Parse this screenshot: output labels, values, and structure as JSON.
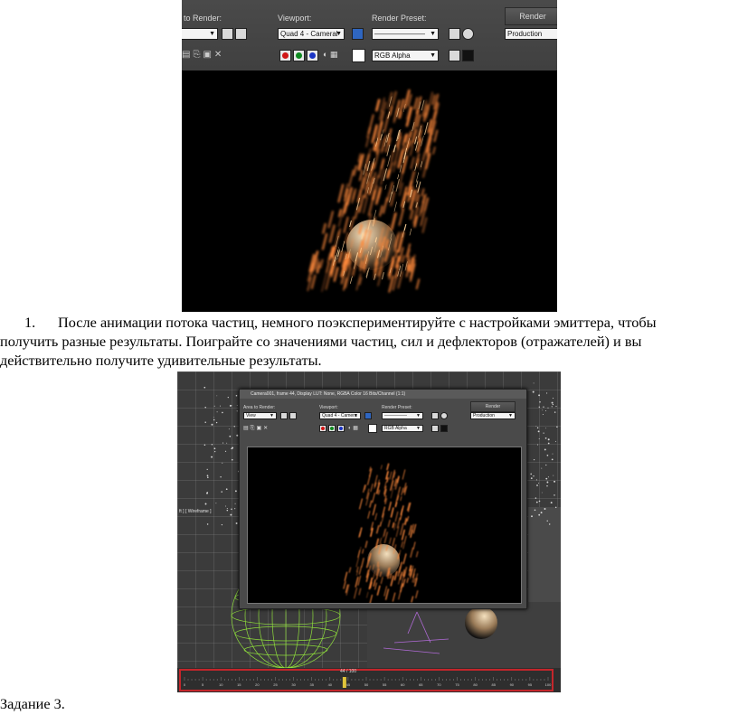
{
  "top_screenshot": {
    "labels": {
      "area_to_render": "to Render:",
      "viewport": "Viewport:",
      "render_preset": "Render Preset:",
      "render_button": "Render"
    },
    "viewport_value": "Quad 4 - Cameral",
    "render_preset_value": "———————",
    "production_value": "Production",
    "channel_value": "RGB Alpha"
  },
  "paragraph": {
    "number": "1.",
    "line1": "После анимации потока частиц, немного поэкспериментируйте с настройками эмиттера, чтобы",
    "line2": "получить разные результаты. Поиграйте со значениями частиц, сил и дефлекторов (отражателей) и вы",
    "line3": "действительно получите удивительные результаты."
  },
  "bottom_screenshot": {
    "window_title": "Camera001, frame 44, Display LUT: None, RGBA Color 16 Bits/Channel (1:1)",
    "labels": {
      "area_to_render": "Area to Render:",
      "viewport": "Viewport:",
      "render_preset": "Render Preset:",
      "render_button": "Render"
    },
    "area_value": "View",
    "viewport_value": "Quad 4 - Camera",
    "render_preset_value": "—————",
    "production_value": "Production",
    "channel_value": "RGB Alpha",
    "viewport_label": "ft ] [ Wireframe ]",
    "timeline_counter": "44 / 100",
    "timeline_ticks": [
      "0",
      "5",
      "10",
      "15",
      "20",
      "25",
      "30",
      "35",
      "40",
      "45",
      "50",
      "55",
      "60",
      "65",
      "70",
      "75",
      "80",
      "85",
      "90",
      "95",
      "100"
    ]
  },
  "task_heading": "Задание 3.",
  "colors": {
    "timeline_frame": "#c4262b",
    "ui_panel": "#444444",
    "spark": "#ff8a3c"
  }
}
